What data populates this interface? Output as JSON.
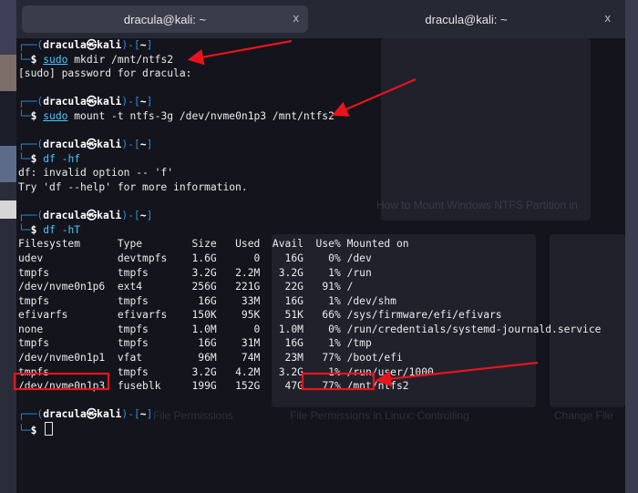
{
  "tabs": [
    {
      "title": "dracula@kali: ~",
      "close_icon": "x"
    },
    {
      "title": "dracula@kali: ~",
      "close_icon": "x"
    }
  ],
  "prompt": {
    "user": "dracula",
    "at": "㉿",
    "host": "kali",
    "cwd": "~",
    "symbol": "$"
  },
  "session": [
    {
      "command_sudo": "sudo",
      "command": " mkdir /mnt/ntfs2",
      "output": [
        "[sudo] password for dracula:"
      ]
    },
    {
      "command_sudo": "sudo",
      "command": " mount -t ntfs-3g /dev/nvme0n1p3 /mnt/ntfs2",
      "output": []
    },
    {
      "command": "df -hf",
      "output": [
        "df: invalid option -- 'f'",
        "Try 'df --help' for more information."
      ]
    },
    {
      "command": "df -hT",
      "output": []
    }
  ],
  "df_table": {
    "headers": [
      "Filesystem",
      "Type",
      "Size",
      "Used",
      "Avail",
      "Use%",
      "Mounted on"
    ],
    "rows": [
      [
        "udev",
        "devtmpfs",
        "1.6G",
        "0",
        "16G",
        "0%",
        "/dev"
      ],
      [
        "tmpfs",
        "tmpfs",
        "3.2G",
        "2.2M",
        "3.2G",
        "1%",
        "/run"
      ],
      [
        "/dev/nvme0n1p6",
        "ext4",
        "256G",
        "221G",
        "22G",
        "91%",
        "/"
      ],
      [
        "tmpfs",
        "tmpfs",
        "16G",
        "33M",
        "16G",
        "1%",
        "/dev/shm"
      ],
      [
        "efivarfs",
        "efivarfs",
        "150K",
        "95K",
        "51K",
        "66%",
        "/sys/firmware/efi/efivars"
      ],
      [
        "none",
        "tmpfs",
        "1.0M",
        "0",
        "1.0M",
        "0%",
        "/run/credentials/systemd-journald.service"
      ],
      [
        "tmpfs",
        "tmpfs",
        "16G",
        "31M",
        "16G",
        "1%",
        "/tmp"
      ],
      [
        "/dev/nvme0n1p1",
        "vfat",
        "96M",
        "74M",
        "23M",
        "77%",
        "/boot/efi"
      ],
      [
        "tmpfs",
        "tmpfs",
        "3.2G",
        "4.2M",
        "3.2G",
        "1%",
        "/run/user/1000"
      ],
      [
        "/dev/nvme0n1p3",
        "fuseblk",
        "199G",
        "152G",
        "47G",
        "77%",
        "/mnt/ntfs2"
      ]
    ]
  },
  "colors": {
    "prompt_frame": "#2a8fe0",
    "command": "#4fc7ff",
    "annotation": "#e8141b",
    "background": "#13141c",
    "tabbar": "#262834"
  },
  "background_text": {
    "article_title": "How to Mount Windows NTFS Partition in",
    "card_left": "File Permissions",
    "card_mid": "File Permissions in Linux: Controlling",
    "card_right": "Change File"
  }
}
